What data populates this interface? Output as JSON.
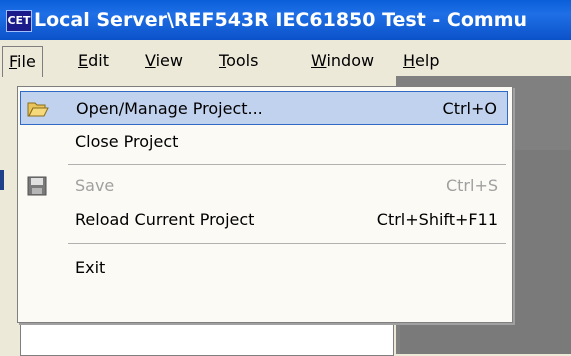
{
  "window": {
    "title": "Local Server\\REF543R IEC61850 Test - Commu",
    "app_icon_text": "CET"
  },
  "menubar": {
    "items": [
      {
        "label": "File",
        "mnemonic": "F",
        "open": true
      },
      {
        "label": "Edit",
        "mnemonic": "E"
      },
      {
        "label": "View",
        "mnemonic": "V"
      },
      {
        "label": "Tools",
        "mnemonic": "T"
      },
      {
        "label": "Window",
        "mnemonic": "W"
      },
      {
        "label": "Help",
        "mnemonic": "H"
      }
    ]
  },
  "file_menu": {
    "items": [
      {
        "label": "Open/Manage Project...",
        "shortcut": "Ctrl+O",
        "icon": "open-folder-icon",
        "selected": true
      },
      {
        "label": "Close Project",
        "shortcut": ""
      },
      {
        "label": "Save",
        "shortcut": "Ctrl+S",
        "icon": "save-disk-icon",
        "disabled": true
      },
      {
        "label": "Reload Current Project",
        "shortcut": "Ctrl+Shift+F11"
      },
      {
        "label": "Exit",
        "shortcut": ""
      }
    ]
  },
  "colors": {
    "titlebar": "#0b52c9",
    "menu_highlight": "#c1d2ee",
    "menu_highlight_border": "#316ac5",
    "disabled_text": "#a0a0a0"
  }
}
